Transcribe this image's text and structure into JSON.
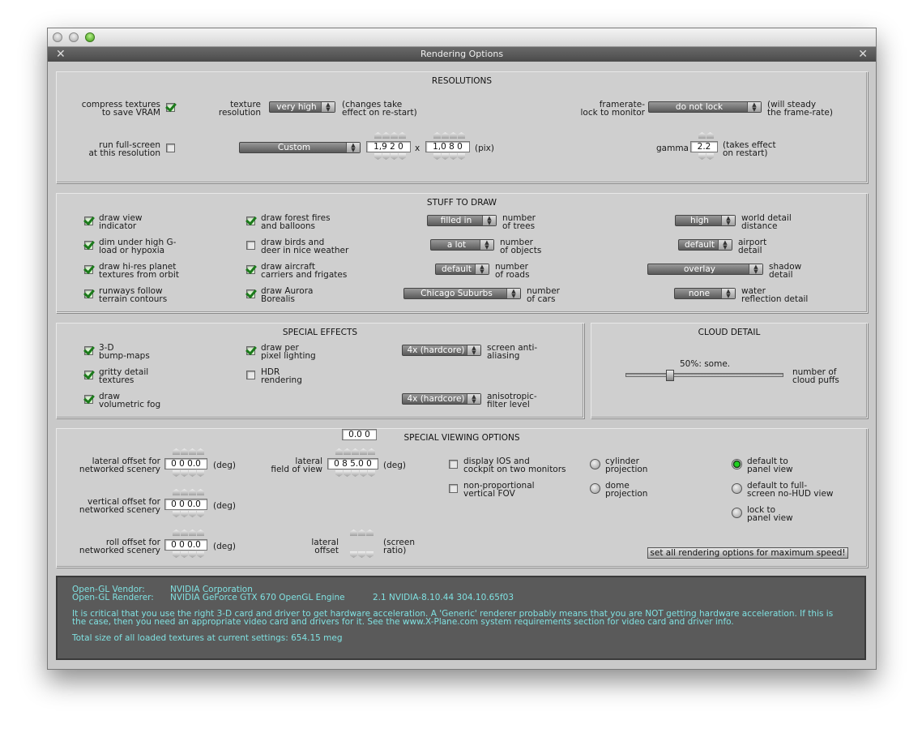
{
  "window": {
    "title": "Rendering Options"
  },
  "resolutions": {
    "title": "RESOLUTIONS",
    "compress_label_1": "compress textures",
    "compress_label_2": "to save VRAM",
    "texture_label_1": "texture",
    "texture_label_2": "resolution",
    "texture_value": "very high",
    "texture_note_1": "(changes take",
    "texture_note_2": "effect on re-start)",
    "framerate_label_1": "framerate-",
    "framerate_label_2": "lock to monitor",
    "framerate_value": "do not lock",
    "framerate_note_1": "(will steady",
    "framerate_note_2": "the frame-rate)",
    "fullscreen_label_1": "run full-screen",
    "fullscreen_label_2": "at this resolution",
    "res_preset": "Custom",
    "width": "1,9 2 0",
    "x_sep": "x",
    "height": "1,0 8 0",
    "pix": "(pix)",
    "gamma_label": "gamma",
    "gamma_value": "2.2",
    "gamma_note_1": "(takes effect",
    "gamma_note_2": "on restart)"
  },
  "stuff": {
    "title": "STUFF TO DRAW",
    "c1": [
      {
        "l1": "draw view",
        "l2": "indicator",
        "checked": true
      },
      {
        "l1": "dim under high G-",
        "l2": "load or hypoxia",
        "checked": true
      },
      {
        "l1": "draw hi-res planet",
        "l2": "textures from orbit",
        "checked": true
      },
      {
        "l1": "runways follow",
        "l2": "terrain contours",
        "checked": true
      }
    ],
    "c2": [
      {
        "l1": "draw forest fires",
        "l2": "and balloons",
        "checked": true
      },
      {
        "l1": "draw birds and",
        "l2": "deer in nice weather",
        "checked": false
      },
      {
        "l1": "draw aircraft",
        "l2": "carriers and frigates",
        "checked": true
      },
      {
        "l1": "draw Aurora",
        "l2": "Borealis",
        "checked": true
      }
    ],
    "c3": [
      {
        "value": "filled in",
        "l1": "number",
        "l2": "of trees"
      },
      {
        "value": "a lot",
        "l1": "number",
        "l2": "of objects"
      },
      {
        "value": "default",
        "l1": "number",
        "l2": "of roads"
      },
      {
        "value": "Chicago Suburbs",
        "l1": "number",
        "l2": "of cars"
      }
    ],
    "c4": [
      {
        "value": "high",
        "l1": "world detail",
        "l2": "distance"
      },
      {
        "value": "default",
        "l1": "airport",
        "l2": "detail"
      },
      {
        "value": "overlay",
        "l1": "shadow",
        "l2": "detail"
      },
      {
        "value": "none",
        "l1": "water",
        "l2": "reflection detail"
      }
    ]
  },
  "effects": {
    "title": "SPECIAL EFFECTS",
    "bump_1": "3-D",
    "bump_2": "bump-maps",
    "gritty_1": "gritty detail",
    "gritty_2": "textures",
    "fog_1": "draw",
    "fog_2": "volumetric fog",
    "pixel_1": "draw per",
    "pixel_2": "pixel lighting",
    "hdr_1": "HDR",
    "hdr_2": "rendering",
    "aa_value": "4x (hardcore)",
    "aa_1": "screen anti-",
    "aa_2": "aliasing",
    "aniso_value": "4x (hardcore)",
    "aniso_1": "anisotropic-",
    "aniso_2": "filter level"
  },
  "cloud": {
    "title": "CLOUD DETAIL",
    "value_label": "50%: some.",
    "level": 0.5,
    "l1": "number of",
    "l2": "cloud puffs"
  },
  "viewing": {
    "title": "SPECIAL VIEWING OPTIONS",
    "lat_1": "lateral offset for",
    "lat_2": "networked scenery",
    "lat_value": "0 0 0.0",
    "vert_1": "vertical offset for",
    "vert_2": "networked scenery",
    "vert_value": "0 0 0.0",
    "roll_1": "roll offset for",
    "roll_2": "networked scenery",
    "roll_value": "0 0 0.0",
    "deg": "(deg)",
    "fov_1": "lateral",
    "fov_2": "field of view",
    "fov_value": "0 8 5.0 0",
    "loff_1": "lateral",
    "loff_2": "offset",
    "loff_value": "0.0 0",
    "ratio_1": "(screen",
    "ratio_2": "ratio)",
    "ios_1": "display IOS and",
    "ios_2": "cockpit on two monitors",
    "nonprop_1": "non-proportional",
    "nonprop_2": "vertical FOV",
    "cyl_1": "cylinder",
    "cyl_2": "projection",
    "dome_1": "dome",
    "dome_2": "projection",
    "def_panel_1": "default to",
    "def_panel_2": "panel view",
    "def_full_1": "default to full-",
    "def_full_2": "screen no-HUD view",
    "lock_1": "lock to",
    "lock_2": "panel view",
    "speed_button": "set all rendering options for maximum speed!"
  },
  "info": {
    "vendor_label": "Open-GL Vendor:",
    "vendor": "NVIDIA Corporation",
    "renderer_label": "Open-GL Renderer:",
    "renderer": "NVIDIA GeForce GTX 670 OpenGL Engine",
    "version": "2.1 NVIDIA-8.10.44 304.10.65f03",
    "warning_1": "It is critical that you use the right 3-D card and driver to get hardware acceleration. A 'Generic' renderer probably means that you are NOT getting hardware acceleration. If this is",
    "warning_2": "the case, then you need an appropriate video card and drivers for it. See the www.X-Plane.com system requirements section for video card and driver info.",
    "total": "Total size of all loaded textures at current settings: 654.15 meg"
  }
}
